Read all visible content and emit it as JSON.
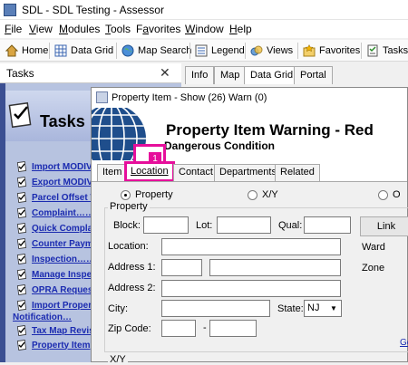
{
  "window": {
    "title": "SDL - SDL Testing - Assessor"
  },
  "menu": [
    {
      "label": "File",
      "key": "F"
    },
    {
      "label": "View",
      "key": "V"
    },
    {
      "label": "Modules",
      "key": "M"
    },
    {
      "label": "Tools",
      "key": "T"
    },
    {
      "label": "Favorites",
      "key": "a"
    },
    {
      "label": "Window",
      "key": "W"
    },
    {
      "label": "Help",
      "key": "H"
    }
  ],
  "toolbar": {
    "home": "Home",
    "data_grid": "Data Grid",
    "map_search": "Map Search",
    "legend": "Legend",
    "views": "Views",
    "favorites": "Favorites",
    "tasks": "Tasks"
  },
  "tasks_panel": {
    "header": "Tasks",
    "close": "✕",
    "title": "Tasks",
    "items": [
      "Import MODIV",
      "Export MODIV",
      "Parcel Offset W",
      "Complaint……",
      "Quick Complain",
      "Counter Paym",
      "Inspection……",
      "Manage Inspe",
      "OPRA Request",
      "Import Propert",
      "Notification…",
      "Tax Map Revis",
      "Property Item"
    ]
  },
  "doc_tabs": [
    "Info",
    "Map",
    "Data Grid",
    "Portal"
  ],
  "dialog": {
    "title": "Property Item - Show (26) Warn (0)",
    "warning_title": "Property Item Warning - Red",
    "warning_subtitle": "Dangerous Condition",
    "badge": "1",
    "tabs": [
      "Item",
      "Location",
      "Contact",
      "Departments",
      "Related"
    ],
    "radios": {
      "property": "Property",
      "xy": "X/Y",
      "other": "O"
    },
    "group": "Property",
    "labels": {
      "block": "Block:",
      "lot": "Lot:",
      "qual": "Qual:",
      "location": "Location:",
      "address1": "Address 1:",
      "address2": "Address 2:",
      "city": "City:",
      "state": "State:",
      "zip": "Zip Code:",
      "zip_sep": "-",
      "ward": "Ward",
      "zone": "Zone",
      "xy_group": "X/Y",
      "go": "Go"
    },
    "values": {
      "state": "NJ"
    },
    "link_button": "Link"
  }
}
